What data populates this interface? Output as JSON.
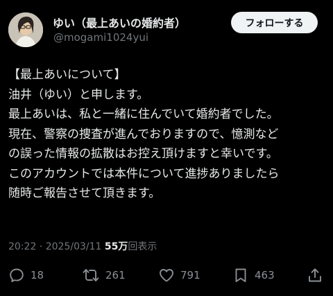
{
  "user": {
    "display_name": "ゆい（最上あいの婚約者）",
    "handle": "@mogami1024yui",
    "follow_label": "フォローする",
    "avatar_icon": "user-photo-icon"
  },
  "post": {
    "lines": [
      "【最上あいについて】",
      "油井（ゆい）と申します。",
      "最上あいは、私と一緒に住んでいて婚約者でした。",
      "現在、警察の捜査が進んでおりますので、憶測など",
      "の誤った情報の拡散はお控え頂けますと幸いです。",
      "このアカウントでは本件について進捗ありましたら",
      "随時ご報告させて頂きます。"
    ]
  },
  "meta": {
    "time": "20:22",
    "separator": " · ",
    "date": "2025/03/11",
    "views_count": "55万",
    "views_label": "回表示"
  },
  "actions": {
    "reply": {
      "icon": "reply-icon",
      "count": "18"
    },
    "repost": {
      "icon": "repost-icon",
      "count": "261"
    },
    "like": {
      "icon": "heart-icon",
      "count": "791"
    },
    "bookmark": {
      "icon": "bookmark-icon",
      "count": "463"
    },
    "share": {
      "icon": "share-icon"
    }
  },
  "colors": {
    "background": "#000000",
    "primary_text": "#e7e9ea",
    "secondary_text": "#71767b",
    "follow_button_bg": "#eff3f4",
    "follow_button_text": "#0f1419"
  }
}
